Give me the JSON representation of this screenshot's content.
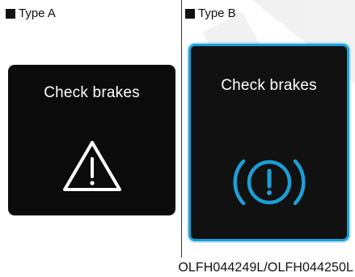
{
  "type_a": {
    "label": "Type A",
    "message": "Check brakes",
    "icon": "warning-triangle-icon"
  },
  "type_b": {
    "label": "Type B",
    "message": "Check brakes",
    "icon": "brake-warning-icon",
    "accent_color": "#1b9fd6"
  },
  "caption": "OLFH044249L/OLFH044250L"
}
